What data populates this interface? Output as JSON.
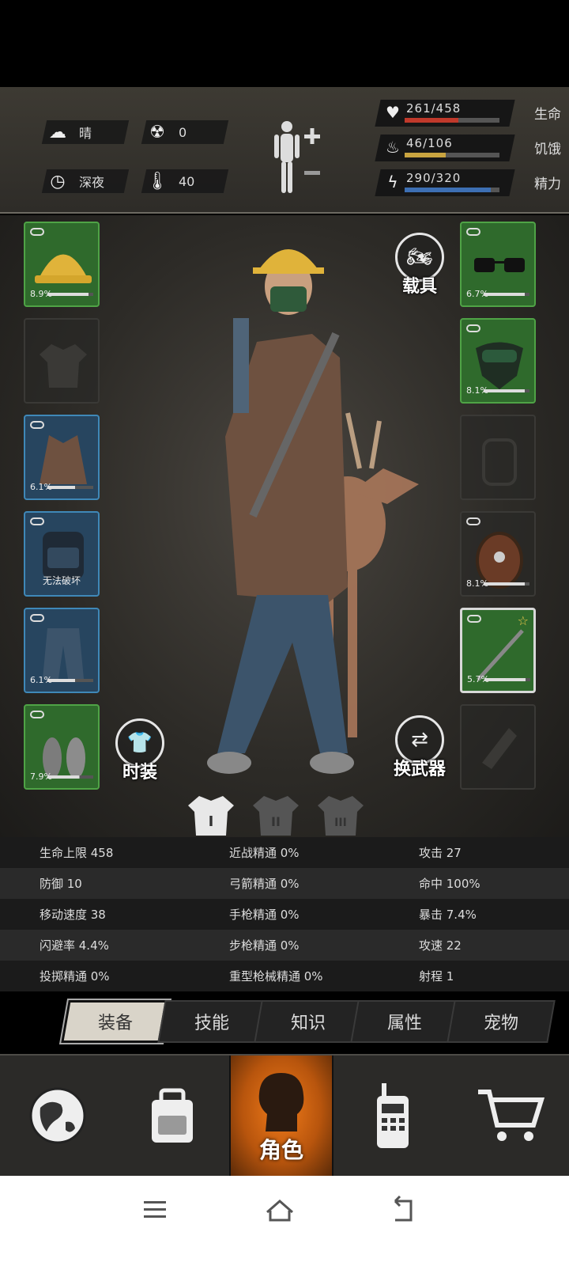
{
  "status": {
    "weather": {
      "icon": "weather-cloudy-icon",
      "label": "晴"
    },
    "radiation": {
      "icon": "radiation-icon",
      "value": "0"
    },
    "time": {
      "icon": "clock-icon",
      "label": "深夜"
    },
    "temperature": {
      "icon": "thermometer-icon",
      "value": "40"
    }
  },
  "vitals": [
    {
      "icon": "heart-icon",
      "value": "261/458",
      "label": "生命",
      "fraction": 0.57,
      "color": "#c0392b"
    },
    {
      "icon": "stomach-icon",
      "value": "46/106",
      "label": "饥饿",
      "fraction": 0.43,
      "color": "#c9a440"
    },
    {
      "icon": "energy-icon",
      "value": "290/320",
      "label": "精力",
      "fraction": 0.91,
      "color": "#3d6fb3"
    }
  ],
  "left_slots": [
    {
      "name": "helmet",
      "rarity": "green",
      "pct": "8.9%",
      "durability": 0.9
    },
    {
      "name": "shirt",
      "rarity": "empty",
      "pct": "",
      "durability": 0
    },
    {
      "name": "jacket",
      "rarity": "blue",
      "pct": "6.1%",
      "durability": 0.6
    },
    {
      "name": "backpack",
      "rarity": "blue",
      "pct": "",
      "note": "无法破坏"
    },
    {
      "name": "pants",
      "rarity": "blue",
      "pct": "6.1%",
      "durability": 0.6
    },
    {
      "name": "shoes",
      "rarity": "green",
      "pct": "7.9%",
      "durability": 0.7
    }
  ],
  "right_slots": [
    {
      "name": "glasses",
      "rarity": "green",
      "pct": "6.7%",
      "durability": 0.9
    },
    {
      "name": "mask",
      "rarity": "green",
      "pct": "8.1%",
      "durability": 0.9
    },
    {
      "name": "bag",
      "rarity": "empty",
      "pct": "",
      "durability": 0
    },
    {
      "name": "shield",
      "rarity": "empty",
      "pct": "8.1%",
      "durability": 0.9
    },
    {
      "name": "weapon",
      "rarity": "sel",
      "pct": "5.7%",
      "durability": 0.9
    },
    {
      "name": "bottle",
      "rarity": "empty",
      "pct": "",
      "durability": 0
    }
  ],
  "buttons": {
    "vehicle": "载具",
    "fashion": "时装",
    "swap_weapon": "换武器"
  },
  "outfit_tabs": [
    "I",
    "II",
    "III"
  ],
  "stats": [
    [
      "生命上限 458",
      "近战精通 0%",
      "攻击 27"
    ],
    [
      "防御 10",
      "弓箭精通 0%",
      "命中 100%"
    ],
    [
      "移动速度 38",
      "手枪精通 0%",
      "暴击 7.4%"
    ],
    [
      "闪避率 4.4%",
      "步枪精通 0%",
      "攻速 22"
    ],
    [
      "投掷精通 0%",
      "重型枪械精通 0%",
      "射程 1"
    ]
  ],
  "tabs": [
    "装备",
    "技能",
    "知识",
    "属性",
    "宠物"
  ],
  "active_tab": 0,
  "nav": [
    {
      "icon": "globe-icon",
      "label": ""
    },
    {
      "icon": "backpack-icon",
      "label": ""
    },
    {
      "icon": "character-icon",
      "label": "角色"
    },
    {
      "icon": "radio-icon",
      "label": ""
    },
    {
      "icon": "cart-icon",
      "label": ""
    }
  ],
  "colors": {
    "accent": "#f07b1a",
    "slot_green": "#2f6a2c",
    "slot_blue": "#27455f"
  }
}
